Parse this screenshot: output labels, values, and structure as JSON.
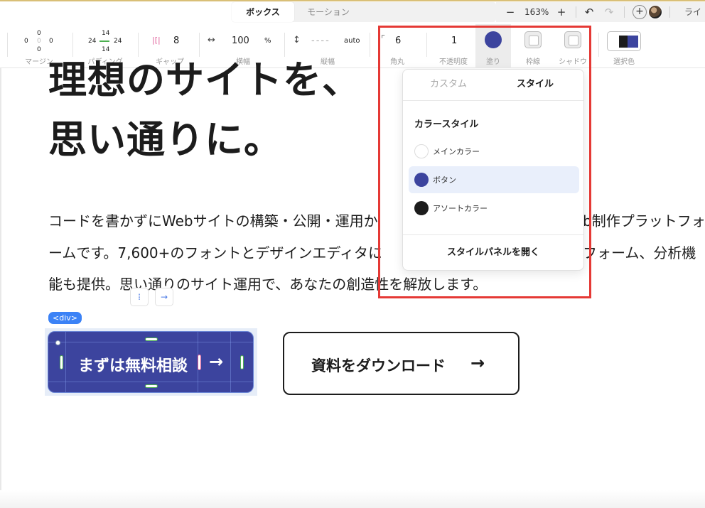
{
  "top_bar": {
    "tabs": [
      {
        "label": "ボックス",
        "active": true
      },
      {
        "label": "モーション",
        "active": false
      }
    ],
    "zoom_out_symbol": "−",
    "zoom_level": "163%",
    "zoom_in_symbol": "+",
    "undo_symbol": "↶",
    "redo_symbol": "↷",
    "add_symbol": "+",
    "right_label": "ライ"
  },
  "properties": {
    "margin": {
      "label": "マージン",
      "top": "0",
      "left": "0",
      "center": "0",
      "right": "0",
      "bottom": "0"
    },
    "padding": {
      "label": "パディング",
      "top": "14",
      "left": "24",
      "right": "24",
      "bottom": "14"
    },
    "gap": {
      "label": "ギャップ",
      "value": "8"
    },
    "width": {
      "label": "横幅",
      "icon": "↔",
      "value": "100",
      "unit": "%"
    },
    "height": {
      "label": "縦幅",
      "icon": "↕",
      "value": "----",
      "unit": "auto"
    },
    "radius": {
      "label": "角丸",
      "value": "6"
    },
    "opacity": {
      "label": "不透明度",
      "value": "1"
    },
    "fill": {
      "label": "塗り",
      "color": "#3c449e"
    },
    "border": {
      "label": "枠線"
    },
    "shadow": {
      "label": "シャドウ"
    },
    "selection_color": {
      "label": "選択色",
      "colors": [
        "#1c1c1c",
        "#3c449e"
      ]
    }
  },
  "canvas": {
    "hero_lines": [
      "理想のサイトを、",
      "思い通りに。"
    ],
    "body_lines": [
      "コードを書かずにWebサイトの構築・公開・運用か",
      "ームです。7,600+のフォントとデザインエディタに",
      "能も提供。思い通りのサイト運用で、あなたの創造性を解放します。"
    ],
    "body_right_fragments": [
      "b制作プラットフォ",
      "フォーム、分析機"
    ],
    "element_tag": "<div>",
    "mini_controls": [
      "⁞",
      "→"
    ],
    "primary_button": {
      "label": "まずは無料相談",
      "arrow": "→",
      "color": "#3c449e"
    },
    "secondary_button": {
      "label": "資料をダウンロード",
      "arrow": "→"
    }
  },
  "fill_dropdown": {
    "tabs": [
      {
        "label": "カスタム",
        "active": false
      },
      {
        "label": "スタイル",
        "active": true
      }
    ],
    "heading": "カラースタイル",
    "items": [
      {
        "label": "メインカラー",
        "color": "#ffffff",
        "selected": false
      },
      {
        "label": "ボタン",
        "color": "#3c449e",
        "selected": true
      },
      {
        "label": "アソートカラー",
        "color": "#1c1c1c",
        "selected": false
      }
    ],
    "footer_action": "スタイルパネルを開く"
  },
  "colors": {
    "accent": "#3c449e",
    "highlight": "#e53935",
    "selection_blue": "#3b82f6",
    "handle_green": "#4caf50"
  }
}
